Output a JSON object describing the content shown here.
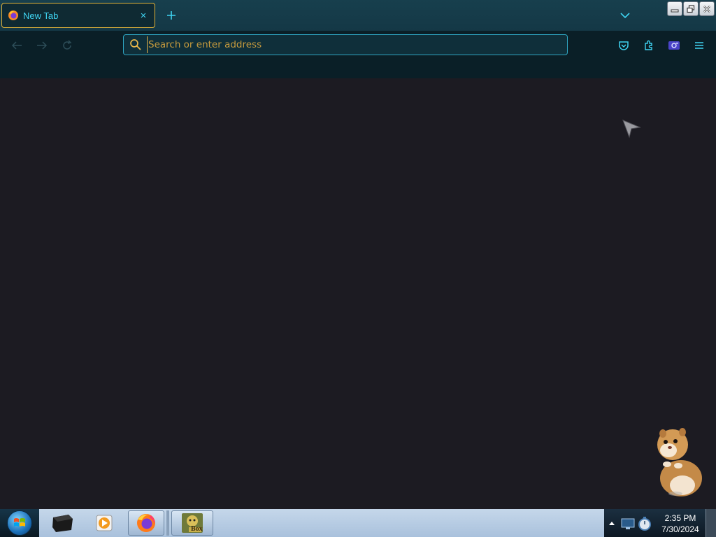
{
  "browser": {
    "tab": {
      "title": "New Tab",
      "close_glyph": "×",
      "favicon": "firefox-icon"
    },
    "newtab_glyph": "+",
    "tablist_icon": "chevron-down-icon",
    "nav": {
      "back_icon": "arrow-left-icon",
      "forward_icon": "arrow-right-icon",
      "reload_icon": "reload-icon"
    },
    "urlbar": {
      "placeholder": "Search or enter address",
      "value": ""
    },
    "toolbar_icons": [
      "pocket-icon",
      "extensions-icon",
      "screenshot-icon",
      "hamburger-menu-icon"
    ]
  },
  "window_controls": [
    "minimize-icon",
    "restore-icon",
    "close-icon"
  ],
  "taskbar": {
    "apps": [
      "start-orb",
      "terminal-app",
      "media-player-app",
      "firefox-app",
      "game-box-app"
    ],
    "game_box_label": "Box",
    "clock": {
      "time": "2:35 PM",
      "date": "7/30/2024"
    }
  },
  "colors": {
    "tabstrip": "#173f4d",
    "navbar": "#0a1f27",
    "content": "#1c1b22",
    "accent": "#3fd4f2",
    "tab_border": "#e2b33a",
    "url_text": "#e8b64a"
  }
}
